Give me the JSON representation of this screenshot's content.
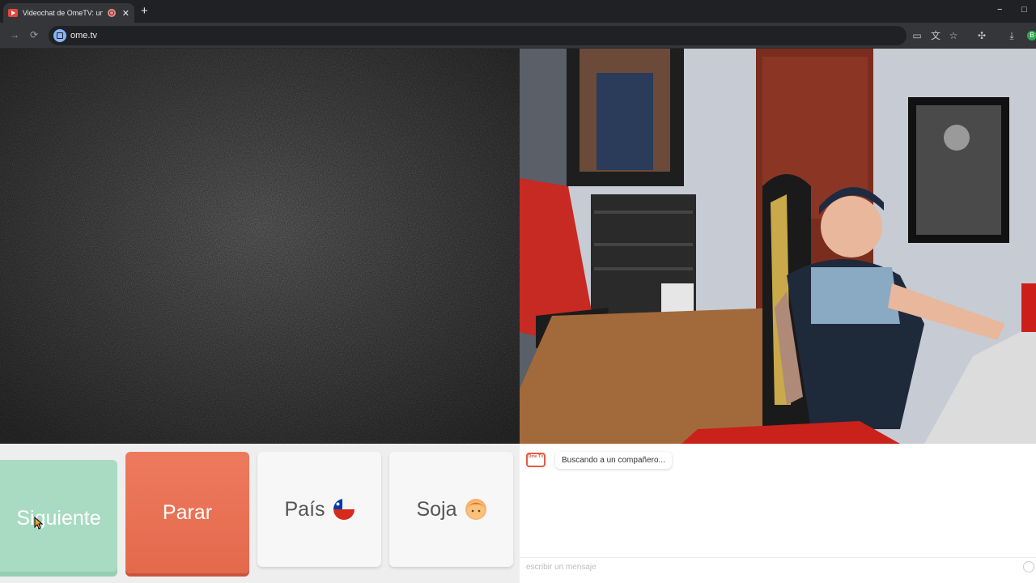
{
  "browser": {
    "tab_title": "Videochat de OmeTV: una a",
    "new_tab": "+",
    "close": "✕",
    "url": "ome.tv",
    "profile_letter": "B",
    "win_minimize": "−",
    "win_maximize": "□"
  },
  "buttons": {
    "next": "Siguiente",
    "stop": "Parar",
    "country": "País",
    "gender": "Soja"
  },
  "chat": {
    "logo_text": "Ome TV",
    "status_message": "Buscando a un compañero...",
    "input_placeholder": "escribir un mensaje"
  },
  "colors": {
    "next": "#a8dbc1",
    "stop": "#e4694c",
    "accent": "#e35b45"
  },
  "icons": {
    "flag": "chile-flag-icon",
    "gender": "boy-face-icon"
  }
}
